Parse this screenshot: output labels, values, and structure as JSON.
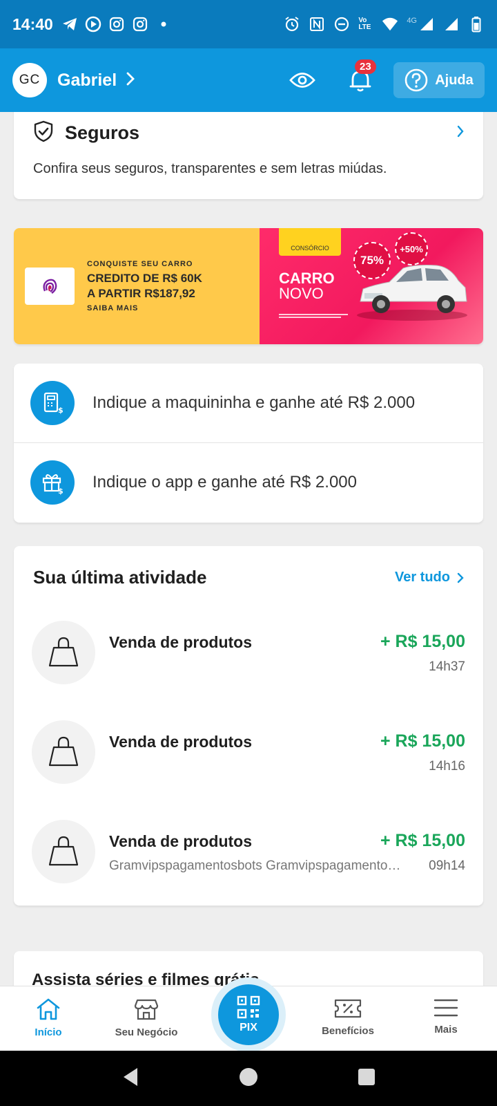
{
  "status_bar": {
    "time": "14:40",
    "network": "4G",
    "volte": "Vo LTE"
  },
  "header": {
    "avatar_initials": "GC",
    "user_name": "Gabriel",
    "notifications_count": "23",
    "help_label": "Ajuda"
  },
  "seguros": {
    "title": "Seguros",
    "description": "Confira seus seguros, transparentes e sem letras miúdas."
  },
  "banner": {
    "line1": "CONQUISTE SEU CARRO",
    "line2": "CREDITO DE R$ 60K",
    "line3": "A PARTIR R$187,92",
    "line4": "SAIBA MAIS",
    "tag": "CONSÓRCIO",
    "carro": "CARRO",
    "novo": "NOVO",
    "stamp1": "75%",
    "stamp2": "+50%"
  },
  "referrals": [
    {
      "text": "Indique a maquininha e ganhe até R$ 2.000"
    },
    {
      "text": "Indique o app e ganhe até R$ 2.000"
    }
  ],
  "activity": {
    "title": "Sua última atividade",
    "see_all": "Ver tudo",
    "items": [
      {
        "name": "Venda de produtos",
        "amount": "+ R$ 15,00",
        "time": "14h37",
        "subtitle": ""
      },
      {
        "name": "Venda de produtos",
        "amount": "+ R$ 15,00",
        "time": "14h16",
        "subtitle": ""
      },
      {
        "name": "Venda de produtos",
        "amount": "+ R$ 15,00",
        "time": "09h14",
        "subtitle": "Gramvipspagamentosbots Gramvipspagamentosbots"
      }
    ]
  },
  "promo": {
    "title": "Assista séries e filmes grátis"
  },
  "bottom_nav": {
    "inicio": "Início",
    "seu_negocio": "Seu Negócio",
    "pix": "PIX",
    "beneficios": "Benefícios",
    "mais": "Mais"
  },
  "colors": {
    "primary": "#0e97dd",
    "status_bar": "#0a7bbd",
    "positive": "#1aa65a",
    "badge": "#e8323c"
  }
}
